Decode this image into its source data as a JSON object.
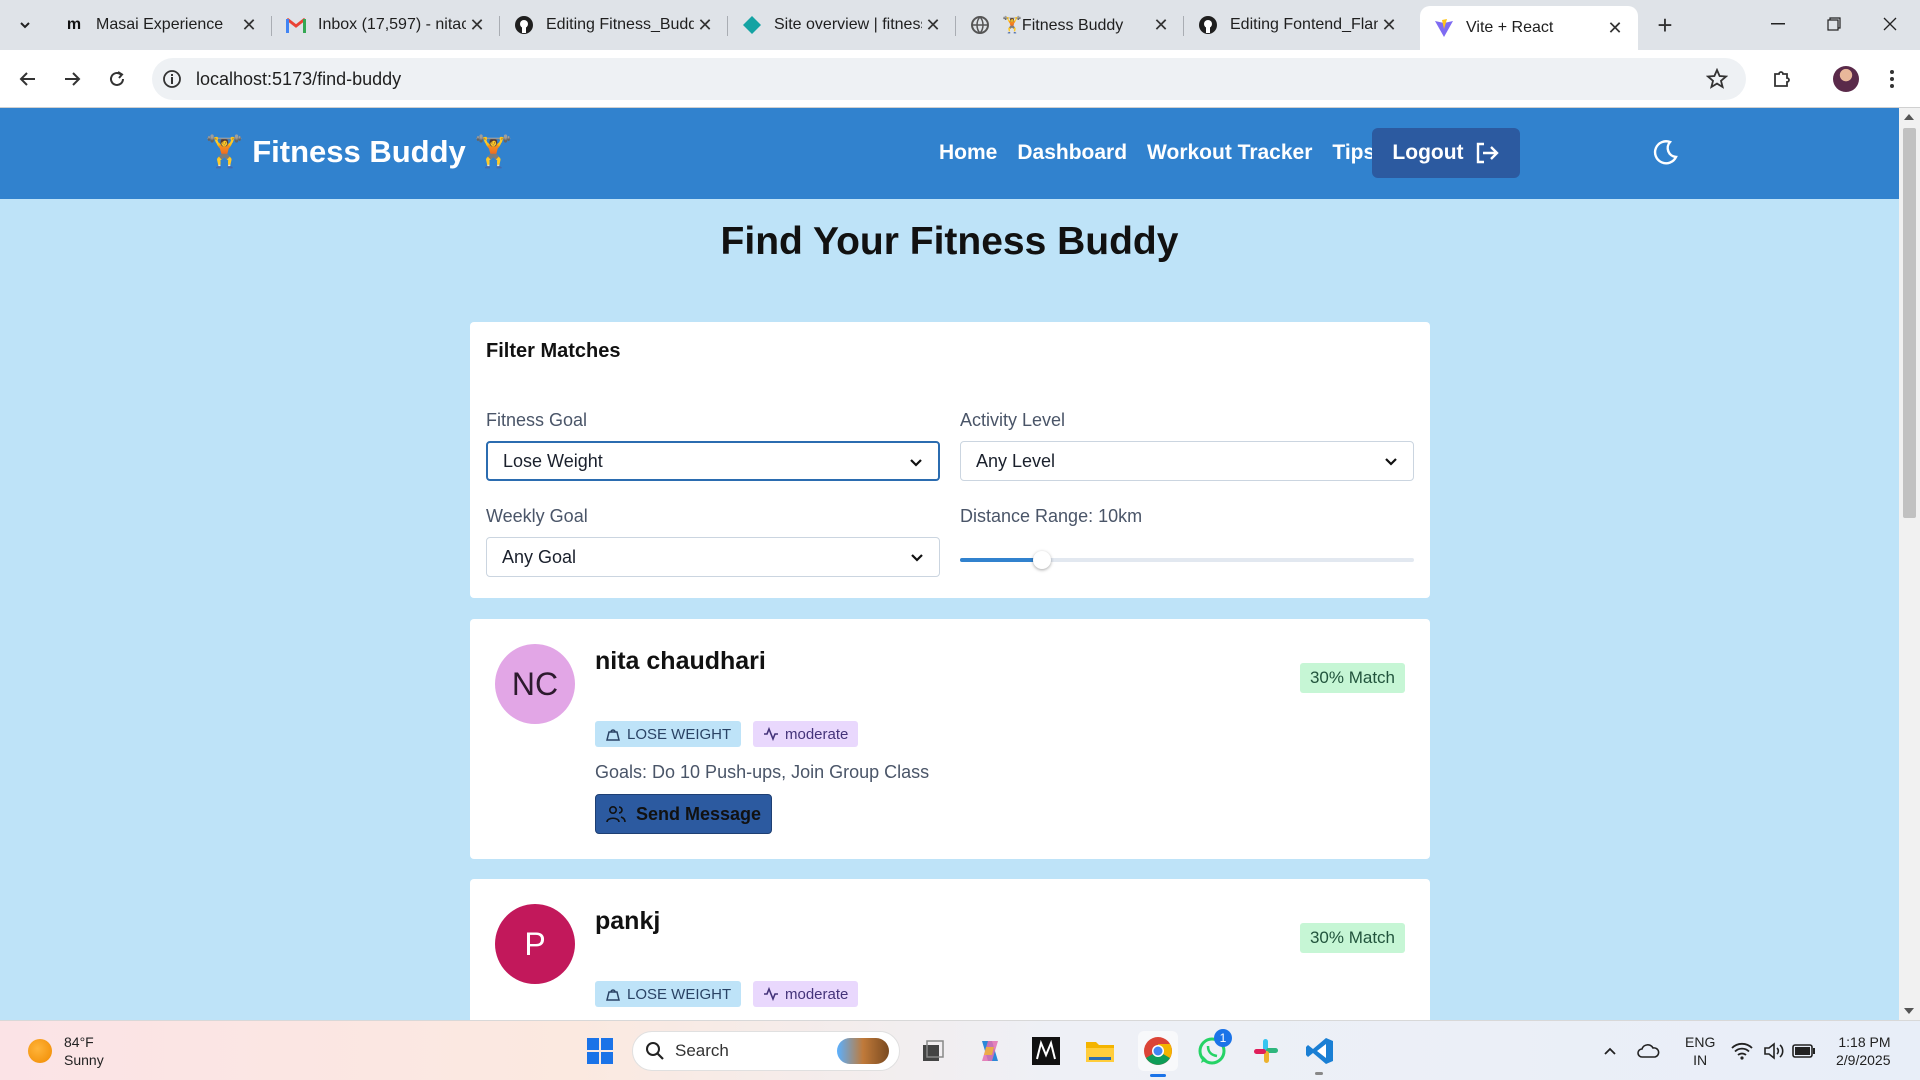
{
  "browser": {
    "tabs": [
      {
        "title": "Masai Experience",
        "favicon": "masai-m"
      },
      {
        "title": "Inbox (17,597) - nitac",
        "favicon": "gmail"
      },
      {
        "title": "Editing Fitness_Buddy",
        "favicon": "github"
      },
      {
        "title": "Site overview | fitness",
        "favicon": "netlify"
      },
      {
        "title": "🏋Fitness Buddy",
        "favicon": "globe"
      },
      {
        "title": "Editing Fontend_Flan",
        "favicon": "github"
      },
      {
        "title": "Vite + React",
        "favicon": "vite",
        "active": true
      }
    ],
    "url": "localhost:5173/find-buddy"
  },
  "nav": {
    "brand": "🏋 Fitness Buddy 🏋",
    "links": [
      "Home",
      "Dashboard",
      "Workout Tracker",
      "Tips"
    ],
    "logout": "Logout"
  },
  "page": {
    "title": "Find Your Fitness Buddy"
  },
  "filters": {
    "heading": "Filter Matches",
    "fitness_goal": {
      "label": "Fitness Goal",
      "value": "Lose Weight"
    },
    "activity_level": {
      "label": "Activity Level",
      "value": "Any Level"
    },
    "weekly_goal": {
      "label": "Weekly Goal",
      "value": "Any Goal"
    },
    "distance": {
      "label": "Distance Range: 10km",
      "fraction": 0.18
    }
  },
  "buddies": [
    {
      "initials": "NC",
      "name": "nita chaudhari",
      "match": "30% Match",
      "goal_tag": "LOSE WEIGHT",
      "level_tag": "moderate",
      "goals": "Goals: Do 10 Push-ups, Join Group Class",
      "button": "Send Message",
      "avatar_bg": "#e2a6e6",
      "avatar_fg": "#2d1a2e"
    },
    {
      "initials": "P",
      "name": "pankj",
      "match": "30% Match",
      "goal_tag": "LOSE WEIGHT",
      "level_tag": "moderate",
      "avatar_bg": "#c2185b",
      "avatar_fg": "#ffffff"
    }
  ],
  "taskbar": {
    "temp": "84°F",
    "condition": "Sunny",
    "search": "Search",
    "lang_1": "ENG",
    "lang_2": "IN",
    "time": "1:18 PM",
    "date": "2/9/2025",
    "whatsapp_badge": "1"
  },
  "colors": {
    "nav_bg": "#3182ce",
    "page_bg": "#bee3f8",
    "button_bg": "#2c5aa0",
    "match_bg": "#c6f6d5"
  }
}
